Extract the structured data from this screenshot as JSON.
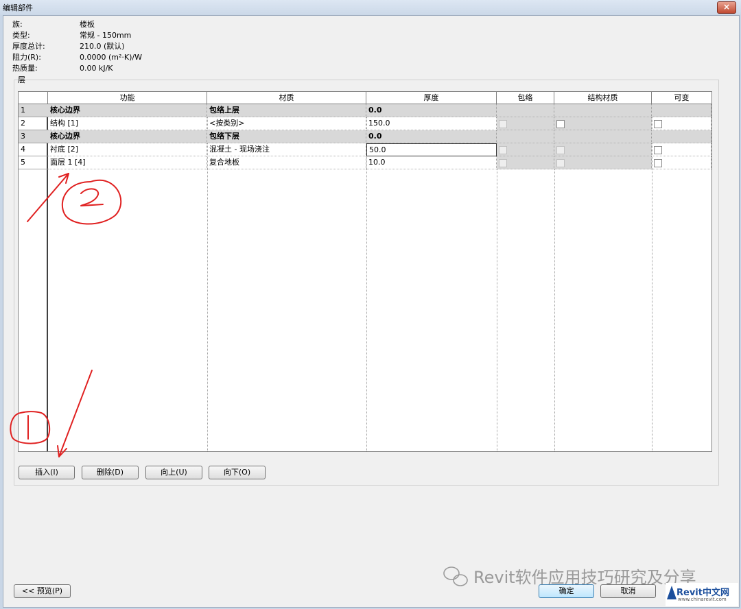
{
  "window": {
    "title": "编辑部件",
    "close_glyph": "×"
  },
  "info": [
    {
      "label": "族:",
      "value": "楼板"
    },
    {
      "label": "类型:",
      "value": "常规 - 150mm"
    },
    {
      "label": "厚度总计:",
      "value": "210.0 (默认)"
    },
    {
      "label": "阻力(R):",
      "value": "0.0000 (m²·K)/W"
    },
    {
      "label": "热质量:",
      "value": "0.00 kJ/K"
    }
  ],
  "layers": {
    "legend": "层",
    "columns": [
      "功能",
      "材质",
      "厚度",
      "包络",
      "结构材质",
      "可变"
    ],
    "rows": [
      {
        "num": "1",
        "function": "核心边界",
        "material": "包络上层",
        "thickness": "0.0",
        "wraps": null,
        "structural": null,
        "variable": null,
        "core": true
      },
      {
        "num": "2",
        "function": "结构 [1]",
        "material": "<按类别>",
        "thickness": "150.0",
        "wraps": false,
        "structural": false,
        "variable": false,
        "core": false
      },
      {
        "num": "3",
        "function": "核心边界",
        "material": "包络下层",
        "thickness": "0.0",
        "wraps": null,
        "structural": null,
        "variable": null,
        "core": true
      },
      {
        "num": "4",
        "function": "衬底 [2]",
        "material": "混凝土 - 现场浇注",
        "thickness": "50.0",
        "wraps": false,
        "structural": false,
        "variable": false,
        "core": false
      },
      {
        "num": "5",
        "function": "面层 1 [4]",
        "material": "复合地板",
        "thickness": "10.0",
        "wraps": false,
        "structural": false,
        "variable": false,
        "core": false
      }
    ]
  },
  "buttons": {
    "insert": "插入(I)",
    "delete": "删除(D)",
    "up": "向上(U)",
    "down": "向下(O)",
    "preview": "<< 预览(P)",
    "ok": "确定",
    "cancel": "取消"
  },
  "annotations": {
    "label_1": "1",
    "label_2": "2",
    "color": "#e02020"
  },
  "watermark": {
    "text": "Revit软件应用技巧研究及分享",
    "logo_text": "Revit中文网",
    "logo_url_text": "www.chinarevit.com"
  }
}
